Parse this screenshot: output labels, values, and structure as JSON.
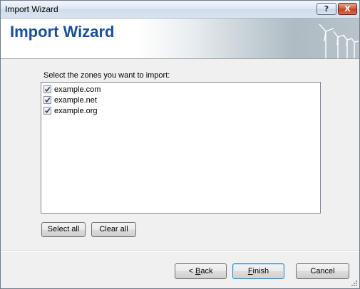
{
  "window": {
    "title": "Import Wizard",
    "help_symbol": "?",
    "close_symbol": "X"
  },
  "header": {
    "title": "Import Wizard",
    "title_color": "#1a4f9c"
  },
  "zones": {
    "label": "Select the zones you want to import:",
    "items": [
      {
        "name": "example.com",
        "checked": true
      },
      {
        "name": "example.net",
        "checked": true
      },
      {
        "name": "example.org",
        "checked": true
      }
    ],
    "select_all_label": "Select all",
    "clear_all_label": "Clear all"
  },
  "footer": {
    "back_prefix": "< ",
    "back_accel": "B",
    "back_rest": "ack",
    "finish_accel": "F",
    "finish_rest": "inish",
    "cancel_label": "Cancel"
  }
}
